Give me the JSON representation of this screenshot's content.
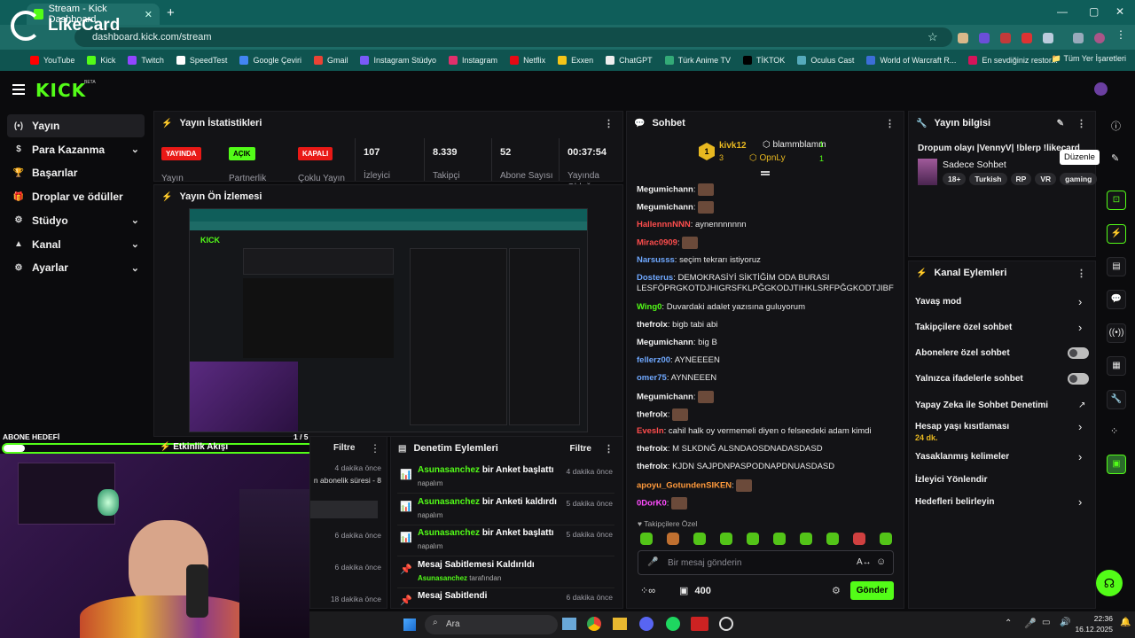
{
  "browser": {
    "tab_title": "Stream - Kick Dashboard",
    "url": "dashboard.kick.com/stream",
    "bookmarks": [
      "YouTube",
      "Kick",
      "Twitch",
      "SpeedTest",
      "Google Çeviri",
      "Gmail",
      "Instagram Stüdyo",
      "Instagram",
      "Netflix",
      "Exxen",
      "ChatGPT",
      "Türk Anime TV",
      "TİKTOK",
      "Oculus Cast",
      "World of Warcraft R...",
      "En sevdiğiniz restor..."
    ],
    "all_bookmarks": "Tüm Yer İşaretleri"
  },
  "overlay": {
    "logo_text": "LikeCard"
  },
  "header": {
    "logo": "KICK",
    "beta": "BETA"
  },
  "sidebar": {
    "items": [
      {
        "label": "Yayın",
        "icon": "(•)"
      },
      {
        "label": "Para Kazanma",
        "icon": "$"
      },
      {
        "label": "Başarılar",
        "icon": "🏆"
      },
      {
        "label": "Droplar ve ödüller",
        "icon": "🎁"
      },
      {
        "label": "Stüdyo",
        "icon": "⚙"
      },
      {
        "label": "Kanal",
        "icon": "▲"
      },
      {
        "label": "Ayarlar",
        "icon": "⚙"
      }
    ]
  },
  "stats": {
    "title": "Yayın İstatistikleri",
    "items": [
      {
        "badge": "YAYINDA",
        "label": "Yayın"
      },
      {
        "badge": "AÇIK",
        "label": "Partnerlik Çalış..."
      },
      {
        "badge": "KAPALI",
        "label": "Çoklu Yayın"
      },
      {
        "value": "107",
        "label": "İzleyici"
      },
      {
        "value": "8.339",
        "label": "Takipçi"
      },
      {
        "value": "52",
        "label": "Abone Sayısı"
      },
      {
        "value": "00:37:54",
        "label": "Yayında Olduğu..."
      }
    ]
  },
  "preview": {
    "title": "Yayın Ön İzlemesi"
  },
  "sub_goal": {
    "label": "ABONE HEDEFİ",
    "count": "1 / 5",
    "progress": 0.2
  },
  "activity": {
    "title": "Etkinlik Akışı",
    "filter": "Filtre",
    "rows": [
      {
        "time": "4 dakika önce",
        "sub": "n abonelik süresi - 8"
      },
      {
        "time": "",
        "sub": ""
      },
      {
        "time": "6 dakika önce",
        "sub": ""
      },
      {
        "time": "6 dakika önce",
        "sub": ""
      },
      {
        "time": "18 dakika önce",
        "sub": ""
      }
    ]
  },
  "moderation": {
    "title": "Denetim Eylemleri",
    "filter": "Filtre",
    "rows": [
      {
        "user": "Asunasanchez",
        "action": "bir Anket başlattı",
        "sub": "napalım",
        "time": "4 dakika önce",
        "icon": "📊"
      },
      {
        "user": "Asunasanchez",
        "action": "bir Anketi kaldırdı",
        "sub": "napalım",
        "time": "5 dakika önce",
        "icon": "📊"
      },
      {
        "user": "Asunasanchez",
        "action": "bir Anket başlattı",
        "sub": "napalım",
        "time": "5 dakika önce",
        "icon": "📊"
      },
      {
        "user": "",
        "action": "Mesaj Sabitlemesi Kaldırıldı",
        "sub_user": "Asunasanchez",
        "sub_suffix": "tarafından",
        "time": "",
        "icon": "📌"
      },
      {
        "user": "",
        "action": "Mesaj Sabitlendi",
        "sub": "",
        "time": "6 dakika önce",
        "icon": "📌"
      }
    ]
  },
  "chat": {
    "title": "Sohbet",
    "top": [
      {
        "name": "kivk12",
        "count": "3",
        "rank": "1"
      },
      {
        "name": "blammblamm",
        "count": "1"
      },
      {
        "name": "OpnLy",
        "count": "1"
      }
    ],
    "messages": [
      {
        "user": "Megumichann",
        "text": "",
        "color": "#f0f0f0"
      },
      {
        "user": "Megumichann",
        "text": "",
        "color": "#f0f0f0"
      },
      {
        "user": "HallennnNNN",
        "text": "aynennnnnnn",
        "color": "#ff4d4d"
      },
      {
        "user": "Mirac0909",
        "text": "",
        "color": "#ff4d4d"
      },
      {
        "user": "Narsusss",
        "text": "seçim tekrarı istiyoruz",
        "color": "#6fa8ff"
      },
      {
        "user": "Dosterus",
        "text": "DEMOKRASİYİ SİKTİĞİM ODA BURASI LESFÖPRGKOTDJHIGRSFKLPĞGKODJTIHKLSRFPĞGKODTJIBF",
        "color": "#6fa8ff"
      },
      {
        "user": "Wing0",
        "text": "Duvardaki adalet yazısına guluyorum",
        "color": "#53fc18"
      },
      {
        "user": "thefrolx",
        "text": "bigb tabi abi",
        "color": "#f0f0f0"
      },
      {
        "user": "Megumichann",
        "text": "big B",
        "color": "#f0f0f0"
      },
      {
        "user": "fellerz00",
        "text": "AYNEEEEN",
        "color": "#6fa8ff"
      },
      {
        "user": "omer75",
        "text": "AYNNEEEN",
        "color": "#6fa8ff"
      },
      {
        "user": "Megumichann",
        "text": "",
        "color": "#f0f0f0"
      },
      {
        "user": "thefrolx",
        "text": "",
        "color": "#f0f0f0"
      },
      {
        "user": "Evesln",
        "text": "cahil halk oy vermemeli diyen o felseedeki adam kimdi",
        "color": "#ff4d4d"
      },
      {
        "user": "thefrolx",
        "text": "M SLKDNĞ ALSNDAOSDNADASDASD",
        "color": "#f0f0f0"
      },
      {
        "user": "thefrolx",
        "text": "KJDN SAJPDNPASPODNAPDNUASDASD",
        "color": "#f0f0f0"
      },
      {
        "user": "apoyu_GotundenSIKEN",
        "text": "",
        "color": "#ff9a3c"
      },
      {
        "user": "0DorK0",
        "text": "",
        "color": "#ff4dff"
      }
    ],
    "followers_only": "Takipçilere Özel",
    "input_placeholder": "Bir mesaj gönderin",
    "points": "400",
    "send": "Gönder"
  },
  "stream_info": {
    "title": "Yayın bilgisi",
    "stream_title": "Dropum olayı |VennyV| !blerp !likecard",
    "category": "Sadece Sohbet",
    "tags": [
      "18+",
      "Turkish",
      "RP",
      "VR",
      "gaming"
    ],
    "tooltip": "Düzenle"
  },
  "channel_actions": {
    "title": "Kanal Eylemleri",
    "rows": [
      {
        "label": "Yavaş mod",
        "type": "chevron"
      },
      {
        "label": "Takipçilere özel sohbet",
        "type": "chevron"
      },
      {
        "label": "Abonelere özel sohbet",
        "type": "toggle"
      },
      {
        "label": "Yalnızca ifadelerle sohbet",
        "type": "toggle"
      },
      {
        "label": "Yapay Zeka ile Sohbet Denetimi",
        "type": "external"
      },
      {
        "label": "Hesap yaşı kısıtlaması",
        "sub": "24 dk.",
        "type": "chevron"
      },
      {
        "label": "Yasaklanmış kelimeler",
        "type": "chevron"
      },
      {
        "label": "İzleyici Yönlendir",
        "type": "none"
      },
      {
        "label": "Hedefleri belirleyin",
        "type": "chevron"
      }
    ]
  },
  "taskbar": {
    "search": "Ara",
    "time": "22:36",
    "date": "16.12.2025"
  },
  "colors": {
    "accent": "#53fc18",
    "live": "#e91916",
    "bg": "#0b0b0d",
    "panel": "#131316"
  }
}
